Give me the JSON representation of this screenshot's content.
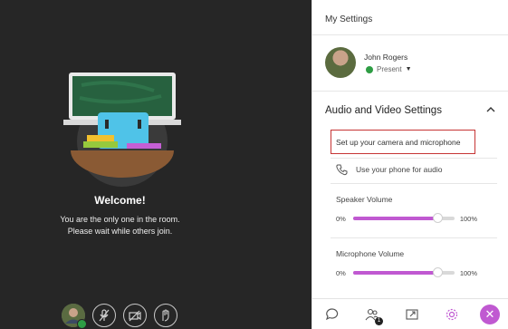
{
  "stage": {
    "welcome": "Welcome!",
    "message_line1": "You are the only one in the room.",
    "message_line2": "Please wait while others join.",
    "controls": [
      "avatar",
      "microphone-muted-icon",
      "camera-off-icon",
      "raise-hand-icon"
    ]
  },
  "panel": {
    "title": "My Settings",
    "user": {
      "name": "John Rogers",
      "status": "Present"
    },
    "section_title": "Audio and Video Settings",
    "setup_link": "Set up your camera and microphone",
    "phone_link": "Use your phone for audio",
    "speaker": {
      "label": "Speaker Volume",
      "min": "0%",
      "max": "100%",
      "value": 0.83
    },
    "microphone": {
      "label": "Microphone Volume",
      "min": "0%",
      "max": "100%",
      "value": 0.83
    },
    "participant_count": "1"
  },
  "colors": {
    "accent": "#c059d1",
    "stage_bg": "#262626",
    "present_green": "#2e9d44",
    "highlight_red": "#c63434"
  }
}
